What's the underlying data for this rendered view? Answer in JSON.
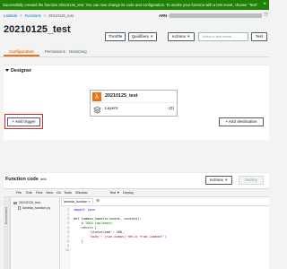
{
  "banner": {
    "message": "Successfully created the function 20210125_test. You can now change its code and configuration. To invoke your function with a test event, choose \"Test\".",
    "close": "×"
  },
  "breadcrumb": {
    "items": [
      "Lambda",
      "Functions",
      "20210125_test"
    ],
    "separator": ">"
  },
  "arn": {
    "label": "ARN -",
    "copy_icon": "copy-icon"
  },
  "header": {
    "title": "20210125_test",
    "throttle": "Throttle",
    "qualifiers": "Qualifiers ▼",
    "actions": "Actions ▼",
    "test_event_placeholder": "Select a test event",
    "test": "Test"
  },
  "tabs": [
    {
      "label": "Configuration",
      "active": true
    },
    {
      "label": "Permissions",
      "active": false
    },
    {
      "label": "Monitoring",
      "active": false
    }
  ],
  "designer": {
    "heading": "Designer",
    "function_name": "20210125_test",
    "layers_label": "Layers",
    "layers_count": "(0)",
    "add_trigger": "+ Add trigger",
    "add_destination": "+ Add destination"
  },
  "function_code": {
    "heading": "Function code",
    "info": "Info",
    "actions": "Actions ▼",
    "deploy": "Deploy"
  },
  "ide": {
    "menu": [
      "File",
      "Edit",
      "Find",
      "View",
      "Go",
      "Tools",
      "Window",
      "Test ▼",
      "Deploy"
    ],
    "side_tab": "Environment",
    "tree": [
      "20210125_test -",
      "lambda_function.py"
    ],
    "editor_tab": "lambda_function ×",
    "line_numbers": [
      "1",
      "2",
      "3",
      "4",
      "5",
      "6",
      "7",
      "8",
      "9",
      "10"
    ],
    "code_lines": [
      "import json",
      "",
      "def lambda_handler(event, context):",
      "    # TODO implement",
      "    return {",
      "        'statusCode': 200,",
      "        'body': json.dumps('Hello from Lambda!')",
      "    }",
      "",
      ""
    ]
  },
  "colors": {
    "banner_green": "#1d8102",
    "accent_orange": "#ec7211",
    "link_blue": "#0073bb",
    "highlight_red": "#e8251c"
  }
}
